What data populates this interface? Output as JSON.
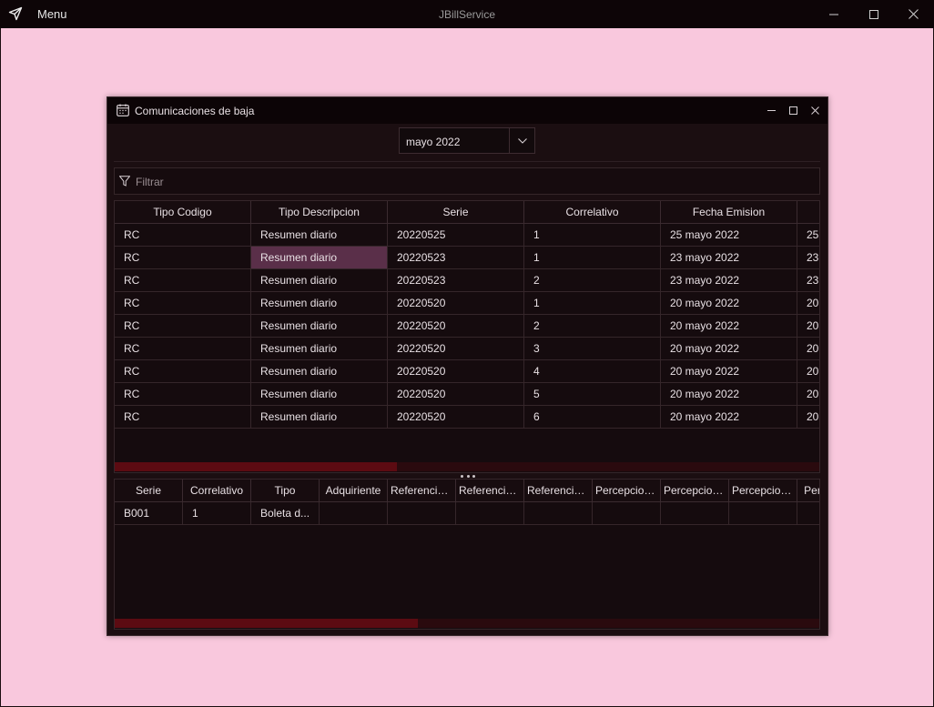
{
  "app": {
    "title": "JBillService",
    "menu_label": "Menu"
  },
  "child_window": {
    "title": "Comunicaciones de baja",
    "month_selector": {
      "value": "mayo 2022"
    },
    "filter": {
      "placeholder": "Filtrar"
    }
  },
  "main_table": {
    "columns": [
      "Tipo Codigo",
      "Tipo Descripcion",
      "Serie",
      "Correlativo",
      "Fecha Emision",
      ""
    ],
    "rows": [
      [
        "RC",
        "Resumen diario",
        "20220525",
        "1",
        "25 mayo 2022",
        "25"
      ],
      [
        "RC",
        "Resumen diario",
        "20220523",
        "1",
        "23 mayo 2022",
        "23"
      ],
      [
        "RC",
        "Resumen diario",
        "20220523",
        "2",
        "23 mayo 2022",
        "23"
      ],
      [
        "RC",
        "Resumen diario",
        "20220520",
        "1",
        "20 mayo 2022",
        "20"
      ],
      [
        "RC",
        "Resumen diario",
        "20220520",
        "2",
        "20 mayo 2022",
        "20"
      ],
      [
        "RC",
        "Resumen diario",
        "20220520",
        "3",
        "20 mayo 2022",
        "20"
      ],
      [
        "RC",
        "Resumen diario",
        "20220520",
        "4",
        "20 mayo 2022",
        "20"
      ],
      [
        "RC",
        "Resumen diario",
        "20220520",
        "5",
        "20 mayo 2022",
        "20"
      ],
      [
        "RC",
        "Resumen diario",
        "20220520",
        "6",
        "20 mayo 2022",
        "20"
      ]
    ],
    "selected_row": 1,
    "selected_col": 1,
    "scroll_fraction": 0.4
  },
  "detail_table": {
    "columns": [
      "Serie",
      "Correlativo",
      "Tipo",
      "Adquiriente",
      "Referencia ...",
      "Referencia ...",
      "Referencia ...",
      "Percepcion...",
      "Percepcion...",
      "Percepcion...",
      "Perc"
    ],
    "rows": [
      [
        "B001",
        "1",
        "Boleta d...",
        "",
        "",
        "",
        "",
        "",
        "",
        "",
        ""
      ]
    ],
    "scroll_fraction": 0.43
  },
  "colors": {
    "desktop": "#f9c8dd",
    "titlebar": "#0d0507",
    "window_bg": "#1b0e11",
    "selection": "#5a2f49",
    "scroll_thumb": "#5c0b12"
  },
  "icons": [
    "send-icon",
    "minimize-icon",
    "maximize-icon",
    "close-icon",
    "calendar-icon",
    "chevron-down-icon",
    "filter-icon"
  ]
}
